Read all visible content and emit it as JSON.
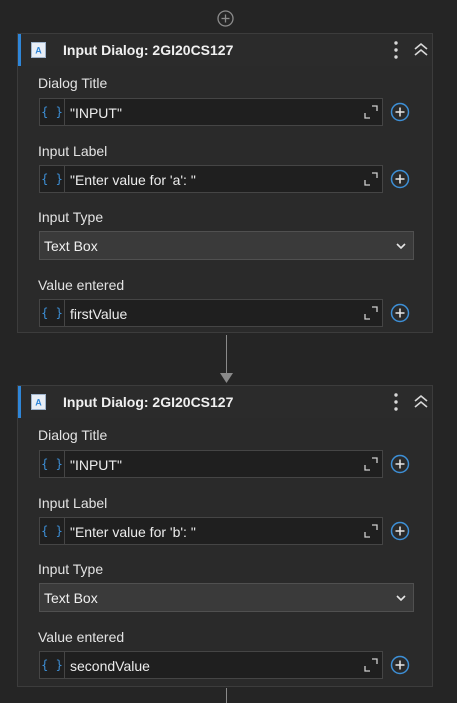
{
  "colors": {
    "background": "#252525",
    "card": "#2a2a2a",
    "accent": "#2f86d8",
    "input_bg": "#1f1f1f",
    "select_bg": "#3a3a3a"
  },
  "cards": [
    {
      "title": "Input Dialog: 2GI20CS127",
      "icon": "input-dialog-icon",
      "dialog_title_label": "Dialog Title",
      "dialog_title_value": "\"INPUT\"",
      "input_label_label": "Input Label",
      "input_label_value": "\"Enter value for 'a': \"",
      "input_type_label": "Input Type",
      "input_type_value": "Text Box",
      "value_entered_label": "Value entered",
      "value_entered_value": "firstValue"
    },
    {
      "title": "Input Dialog: 2GI20CS127",
      "icon": "input-dialog-icon",
      "dialog_title_label": "Dialog Title",
      "dialog_title_value": "\"INPUT\"",
      "input_label_label": "Input Label",
      "input_label_value": "\"Enter value for 'b': \"",
      "input_type_label": "Input Type",
      "input_type_value": "Text Box",
      "value_entered_label": "Value entered",
      "value_entered_value": "secondValue"
    }
  ],
  "brace_glyph": "{ }"
}
